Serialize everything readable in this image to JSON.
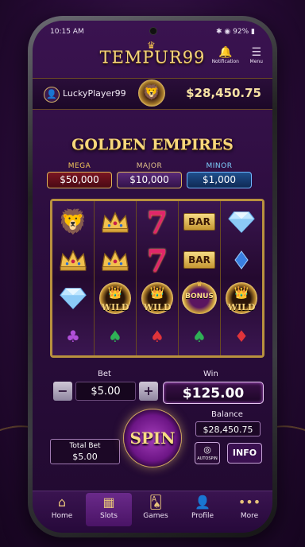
{
  "status": {
    "time": "10:15 AM",
    "battery": "92%"
  },
  "header": {
    "logo": "TEMPUR99",
    "notification_label": "Notification",
    "menu_label": "Menu"
  },
  "user": {
    "name": "LuckyPlayer99",
    "credits": "$28,450.75"
  },
  "game": {
    "title": "GOLDEN EMPIRES"
  },
  "jackpots": {
    "mega": {
      "name": "MEGA",
      "value": "$50,000"
    },
    "major": {
      "name": "MAJOR",
      "value": "$10,000"
    },
    "minor": {
      "name": "MINOR",
      "value": "$1,000"
    }
  },
  "reels": [
    [
      "lion",
      "crown",
      "diamond",
      "club"
    ],
    [
      "crown",
      "crown",
      "wild",
      "spade"
    ],
    [
      "seven",
      "seven",
      "wild",
      "spade-red"
    ],
    [
      "bar",
      "bar",
      "bonus",
      "spade"
    ],
    [
      "diamond",
      "blue-gem",
      "wild",
      "red-diamond"
    ]
  ],
  "symbol_labels": {
    "bar": "BAR",
    "wild": "WILD",
    "bonus": "BONUS",
    "seven": "7"
  },
  "controls": {
    "bet_label": "Bet",
    "bet_value": "$5.00",
    "minus": "−",
    "plus": "+",
    "win_label": "Win",
    "win_value": "$125.00",
    "balance_label": "Balance",
    "balance_value": "$28,450.75",
    "total_bet_label": "Total Bet",
    "total_bet_value": "$5.00",
    "spin_label": "SPIN",
    "auto_label": "AUTOSPIN",
    "info_label": "INFO"
  },
  "tabs": [
    {
      "label": "Home",
      "icon": "home-icon"
    },
    {
      "label": "Slots",
      "icon": "slots-icon",
      "active": true
    },
    {
      "label": "Games",
      "icon": "cards-icon"
    },
    {
      "label": "Profile",
      "icon": "profile-icon"
    },
    {
      "label": "More",
      "icon": "more-icon"
    }
  ],
  "colors": {
    "gold": "#f2d27a",
    "purple_bg": "#2c0d3e",
    "win_border": "#e7c7f2"
  }
}
